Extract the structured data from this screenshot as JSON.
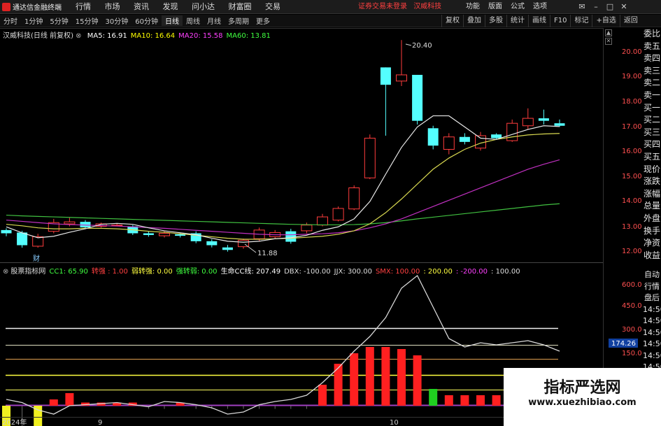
{
  "app": {
    "title": "通达信金融终端"
  },
  "menu": [
    "行情",
    "市场",
    "资讯",
    "发现",
    "问小达",
    "财富圈",
    "交易"
  ],
  "security_notice": "证券交易未登录",
  "stock_name": "汉威科技",
  "right_menu": [
    "功能",
    "版面",
    "公式",
    "选项"
  ],
  "timeframes": [
    "分时",
    "1分钟",
    "5分钟",
    "15分钟",
    "30分钟",
    "60分钟",
    "日线",
    "周线",
    "月线",
    "多周期",
    "更多"
  ],
  "active_timeframe": "日线",
  "toolbar": [
    "复权",
    "叠加",
    "多股",
    "统计",
    "画线",
    "F10",
    "标记",
    "+自选",
    "返回"
  ],
  "chart_info": {
    "title": "汉威科技(日线 前复权)",
    "ma": [
      {
        "label": "MA5: 16.91",
        "color": "#ffffff"
      },
      {
        "label": "MA10: 16.64",
        "color": "#ffff00"
      },
      {
        "label": "MA20: 15.58",
        "color": "#ff40ff"
      },
      {
        "label": "MA60: 13.81",
        "color": "#40ff40"
      }
    ]
  },
  "indicator_info": [
    {
      "text": "股票指标网",
      "color": "#dddddd"
    },
    {
      "text": "CC1: 65.90",
      "color": "#40ff40"
    },
    {
      "text": "转强 : 1.00",
      "color": "#ff4040"
    },
    {
      "text": "弱转强: 0.00",
      "color": "#ffff40"
    },
    {
      "text": "强转弱: 0.00",
      "color": "#40ff40"
    },
    {
      "text": "生命CC线: 207.49",
      "color": "#ffffff"
    },
    {
      "text": "DBX: -100.00",
      "color": "#dddddd"
    },
    {
      "text": "JJX: 300.00",
      "color": "#dddddd"
    },
    {
      "text": "SMX: 100.00",
      "color": "#ff4040"
    },
    {
      "text": ": 200.00",
      "color": "#ffff40"
    },
    {
      "text": ": -200.00",
      "color": "#ff40ff"
    },
    {
      "text": ": 100.00",
      "color": "#dddddd"
    }
  ],
  "side_labels": [
    "委比",
    "卖五",
    "卖四",
    "卖三",
    "卖二",
    "卖一",
    "买一",
    "买二",
    "买三",
    "买四",
    "买五",
    "现价",
    "涨跌",
    "涨幅",
    "总量",
    "外盘",
    "换手",
    "净资",
    "收益"
  ],
  "side_labels2": [
    "自动",
    "行情",
    "盘后",
    "14:50",
    "14:50",
    "14:50",
    "14:50",
    "14:50",
    "14:50",
    "14:50",
    "14:50",
    "14:50",
    "14:50"
  ],
  "price_axis": [
    "20.00",
    "19.00",
    "18.00",
    "17.00",
    "16.00",
    "15.00",
    "14.00",
    "13.00",
    "12.00"
  ],
  "indicator_axis": [
    "600.0",
    "450.0",
    "300.0",
    "150.0"
  ],
  "current_value": "174.26",
  "annotations": {
    "high": "20.40",
    "low": "11.88",
    "fin": "财"
  },
  "date_labels": [
    "2024年",
    "9",
    "10"
  ],
  "watermark": {
    "line1": "指标严选网",
    "line2": "www.xuezhibiao.com"
  },
  "chart_data": {
    "type": "candlestick",
    "candles": [
      {
        "o": 12.75,
        "c": 12.62,
        "h": 12.82,
        "l": 12.5
      },
      {
        "o": 12.65,
        "c": 12.14,
        "h": 12.72,
        "l": 12.04
      },
      {
        "o": 12.1,
        "c": 12.48,
        "h": 12.6,
        "l": 12.04
      },
      {
        "o": 12.7,
        "c": 13.05,
        "h": 13.2,
        "l": 12.62
      },
      {
        "o": 13.0,
        "c": 13.08,
        "h": 13.25,
        "l": 12.9
      },
      {
        "o": 13.08,
        "c": 12.86,
        "h": 13.15,
        "l": 12.8
      },
      {
        "o": 12.9,
        "c": 13.0,
        "h": 13.05,
        "l": 12.85
      },
      {
        "o": 12.95,
        "c": 12.95,
        "h": 13.0,
        "l": 12.9
      },
      {
        "o": 12.9,
        "c": 12.62,
        "h": 12.95,
        "l": 12.55
      },
      {
        "o": 12.62,
        "c": 12.55,
        "h": 12.7,
        "l": 12.48
      },
      {
        "o": 12.52,
        "c": 12.62,
        "h": 12.7,
        "l": 12.45
      },
      {
        "o": 12.58,
        "c": 12.52,
        "h": 12.62,
        "l": 12.45
      },
      {
        "o": 12.62,
        "c": 12.3,
        "h": 12.7,
        "l": 12.22
      },
      {
        "o": 12.3,
        "c": 12.14,
        "h": 12.38,
        "l": 12.05
      },
      {
        "o": 12.05,
        "c": 11.95,
        "h": 12.15,
        "l": 11.88
      },
      {
        "o": 12.08,
        "c": 12.34,
        "h": 12.4,
        "l": 12.0
      },
      {
        "o": 12.4,
        "c": 12.75,
        "h": 12.85,
        "l": 12.3
      },
      {
        "o": 12.48,
        "c": 12.65,
        "h": 12.75,
        "l": 12.42
      },
      {
        "o": 12.7,
        "c": 12.28,
        "h": 12.8,
        "l": 12.2
      },
      {
        "o": 12.72,
        "c": 12.95,
        "h": 13.05,
        "l": 12.62
      },
      {
        "o": 12.95,
        "c": 13.28,
        "h": 13.4,
        "l": 12.9
      },
      {
        "o": 13.15,
        "c": 13.62,
        "h": 13.7,
        "l": 13.1
      },
      {
        "o": 13.6,
        "c": 14.45,
        "h": 14.55,
        "l": 13.55
      },
      {
        "o": 14.85,
        "c": 16.45,
        "h": 16.6,
        "l": 14.8
      },
      {
        "o": 19.3,
        "c": 18.6,
        "h": 19.3,
        "l": 16.55
      },
      {
        "o": 18.75,
        "c": 19.0,
        "h": 20.4,
        "l": 18.55
      },
      {
        "o": 19.0,
        "c": 17.15,
        "h": 19.0,
        "l": 17.0
      },
      {
        "o": 16.85,
        "c": 16.15,
        "h": 16.95,
        "l": 16.0
      },
      {
        "o": 16.0,
        "c": 16.5,
        "h": 16.65,
        "l": 15.8
      },
      {
        "o": 16.5,
        "c": 16.3,
        "h": 16.65,
        "l": 16.2
      },
      {
        "o": 16.05,
        "c": 16.55,
        "h": 16.7,
        "l": 15.95
      },
      {
        "o": 16.6,
        "c": 16.45,
        "h": 16.65,
        "l": 16.4
      },
      {
        "o": 16.35,
        "c": 17.05,
        "h": 17.2,
        "l": 16.3
      },
      {
        "o": 16.95,
        "c": 17.25,
        "h": 17.65,
        "l": 16.8
      },
      {
        "o": 17.25,
        "c": 17.15,
        "h": 17.6,
        "l": 17.0
      },
      {
        "o": 17.05,
        "c": 16.95,
        "h": 17.2,
        "l": 16.9
      }
    ],
    "ma5": [
      12.88,
      12.64,
      12.44,
      12.5,
      12.66,
      12.8,
      12.98,
      13.02,
      12.98,
      12.84,
      12.72,
      12.64,
      12.56,
      12.42,
      12.3,
      12.26,
      12.3,
      12.4,
      12.44,
      12.54,
      12.74,
      12.88,
      13.2,
      13.9,
      15.0,
      16.08,
      16.9,
      17.35,
      17.35,
      16.9,
      16.45,
      16.4,
      16.6,
      16.8,
      16.95,
      16.92
    ],
    "ma10": [
      12.98,
      12.92,
      12.84,
      12.8,
      12.8,
      12.82,
      12.82,
      12.8,
      12.76,
      12.7,
      12.66,
      12.6,
      12.54,
      12.48,
      12.42,
      12.38,
      12.38,
      12.4,
      12.42,
      12.46,
      12.5,
      12.58,
      12.72,
      13.0,
      13.45,
      14.0,
      14.6,
      15.2,
      15.65,
      16.0,
      16.25,
      16.4,
      16.5,
      16.58,
      16.62,
      16.64
    ],
    "ma20": [
      13.15,
      13.1,
      13.05,
      13.0,
      12.97,
      12.95,
      12.93,
      12.91,
      12.88,
      12.85,
      12.82,
      12.78,
      12.74,
      12.7,
      12.66,
      12.62,
      12.58,
      12.56,
      12.56,
      12.58,
      12.6,
      12.64,
      12.72,
      12.84,
      13.0,
      13.2,
      13.45,
      13.7,
      13.95,
      14.2,
      14.45,
      14.7,
      14.95,
      15.2,
      15.4,
      15.58
    ],
    "ma60": [
      13.35,
      13.32,
      13.3,
      13.28,
      13.26,
      13.24,
      13.22,
      13.2,
      13.18,
      13.16,
      13.14,
      13.12,
      13.1,
      13.08,
      13.06,
      13.04,
      13.02,
      13.0,
      12.98,
      12.97,
      12.96,
      12.96,
      12.97,
      13.0,
      13.05,
      13.12,
      13.2,
      13.27,
      13.34,
      13.41,
      13.48,
      13.55,
      13.62,
      13.69,
      13.76,
      13.81
    ],
    "cc_line": [
      30,
      15,
      -20,
      -40,
      0,
      5,
      10,
      15,
      5,
      -5,
      20,
      15,
      5,
      -10,
      -40,
      -30,
      5,
      20,
      30,
      50,
      110,
      180,
      260,
      330,
      420,
      560,
      620,
      470,
      320,
      280,
      300,
      290,
      300,
      310,
      290,
      260
    ],
    "bars": [
      -120,
      -120,
      -120,
      30,
      60,
      15,
      15,
      15,
      15,
      -15,
      -15,
      15,
      -15,
      -15,
      -15,
      -15,
      -15,
      -15,
      -15,
      -15,
      100,
      200,
      250,
      280,
      280,
      270,
      240,
      80,
      50,
      50,
      50,
      50,
      50,
      50,
      50,
      50
    ],
    "bar_colors": [
      "y",
      "n",
      "y",
      "r",
      "r",
      "r",
      "r",
      "r",
      "r",
      "n",
      "n",
      "r",
      "n",
      "n",
      "n",
      "n",
      "n",
      "n",
      "n",
      "n",
      "r",
      "r",
      "r",
      "r",
      "r",
      "r",
      "r",
      "g",
      "r",
      "r",
      "r",
      "r",
      "r",
      "r",
      "r",
      "r"
    ]
  }
}
